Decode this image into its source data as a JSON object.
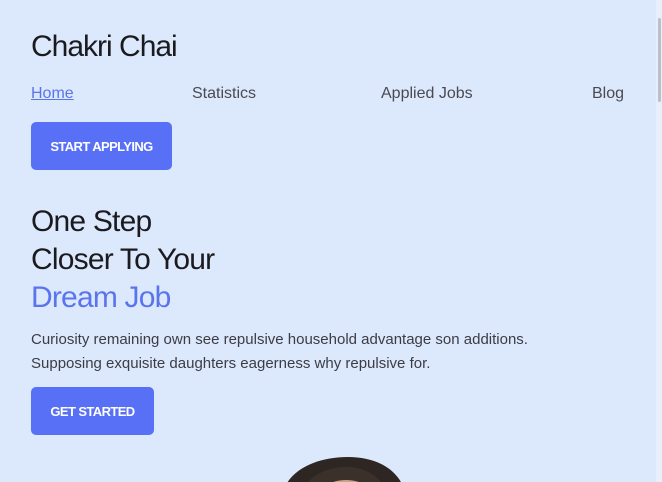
{
  "brand": "Chakri Chai",
  "nav": {
    "home": "Home",
    "statistics": "Statistics",
    "applied_jobs": "Applied Jobs",
    "blog": "Blog"
  },
  "cta": {
    "start_applying": "START APPLYING",
    "get_started": "GET STARTED"
  },
  "hero": {
    "line1": "One Step",
    "line2": "Closer To Your",
    "line3": "Dream Job",
    "desc1": "Curiosity remaining own see repulsive household advantage son additions.",
    "desc2": "Supposing exquisite daughters eagerness why repulsive for."
  },
  "colors": {
    "background": "#dce8fc",
    "accent": "#5a74ee",
    "button": "#5870f5",
    "text": "#1b1b1f"
  }
}
